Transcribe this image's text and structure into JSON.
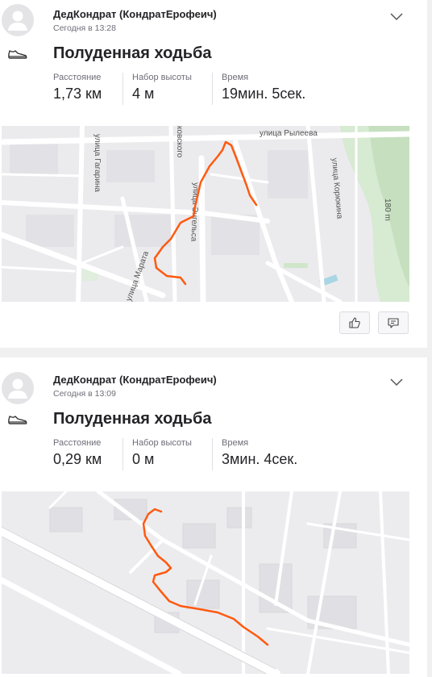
{
  "feed": {
    "activities": [
      {
        "athlete": "ДедКондрат (КондратЕрофеич)",
        "timestamp": "Сегодня в 13:28",
        "sport_icon": "shoe-icon",
        "title": "Полуденная ходьба",
        "stats": [
          {
            "label": "Расстояние",
            "value": "1,73 км"
          },
          {
            "label": "Набор высоты",
            "value": "4 м"
          },
          {
            "label": "Время",
            "value": "19мин. 5сек."
          }
        ],
        "map": {
          "streets": [
            "улица Рылеева",
            "улица Гагарина",
            "улица Корюкина",
            "улица Марата",
            "улица Энгельса",
            "ковского",
            "180 m"
          ],
          "route_color": "#ff5a10"
        },
        "actions": [
          "thumbs-up-icon",
          "comment-icon"
        ]
      },
      {
        "athlete": "ДедКондрат (КондратЕрофеич)",
        "timestamp": "Сегодня в 13:09",
        "sport_icon": "shoe-icon",
        "title": "Полуденная ходьба",
        "stats": [
          {
            "label": "Расстояние",
            "value": "0,29 км"
          },
          {
            "label": "Набор высоты",
            "value": "0 м"
          },
          {
            "label": "Время",
            "value": "3мин. 4сек."
          }
        ],
        "map": {
          "route_color": "#ff5a10"
        },
        "actions": [
          "thumbs-up-icon",
          "comment-icon"
        ]
      }
    ]
  },
  "colors": {
    "route": "#ff5a10",
    "map_bg": "#eaeaed",
    "road": "#ffffff",
    "park": "#cfe6c9",
    "water": "#b6dbe8"
  }
}
